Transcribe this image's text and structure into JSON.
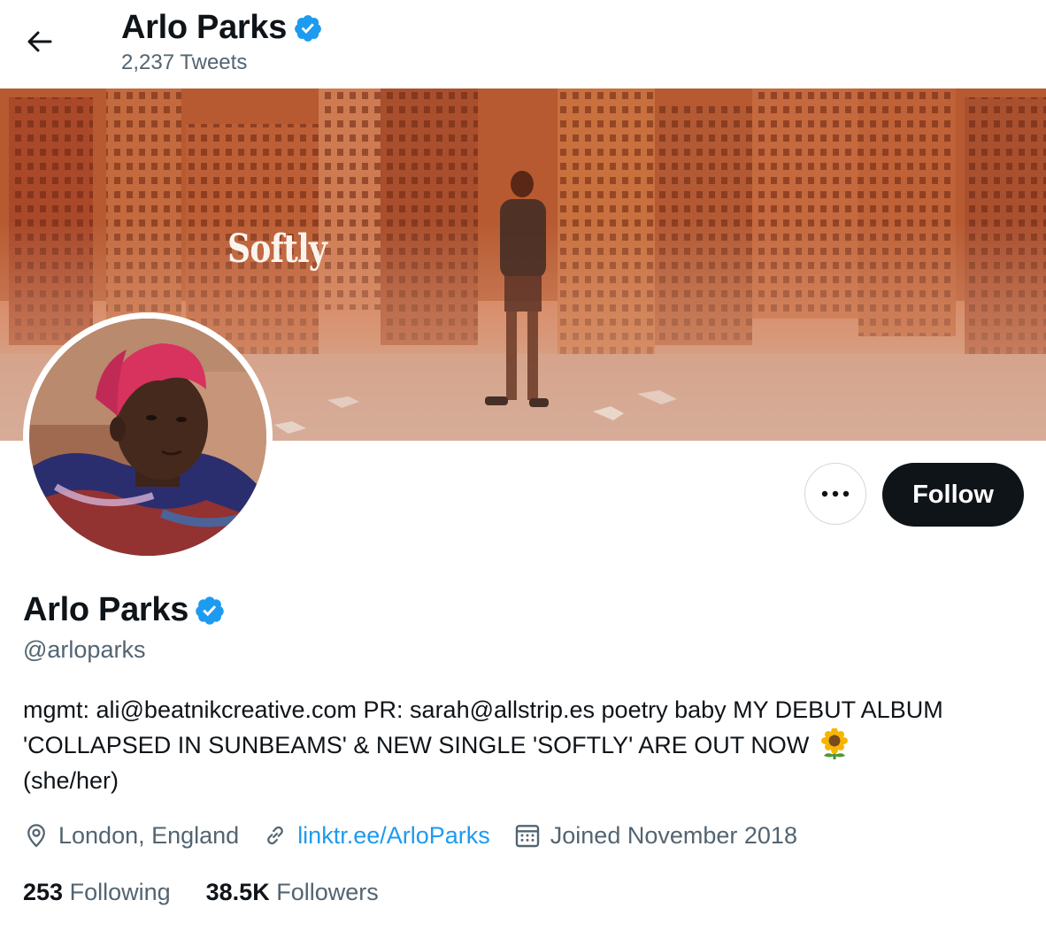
{
  "header": {
    "back_icon": "arrow-left-icon",
    "title": "Arlo Parks",
    "tweet_count": "2,237 Tweets"
  },
  "banner": {
    "logo_text": "Softly"
  },
  "actions": {
    "more_icon": "more-horizontal-icon",
    "follow_label": "Follow"
  },
  "profile": {
    "name": "Arlo Parks",
    "verified_icon": "verified-badge-icon",
    "handle": "@arloparks",
    "bio": "mgmt: ali@beatnikcreative.com PR: sarah@allstrip.es poetry baby MY DEBUT ALBUM 'COLLAPSED IN SUNBEAMS' & NEW SINGLE 'SOFTLY' ARE OUT NOW",
    "bio_emoji": "sunflower",
    "bio_end": "(she/her)",
    "location": "London, England",
    "location_icon": "location-pin-icon",
    "website": "linktr.ee/ArloParks",
    "website_icon": "link-icon",
    "joined": "Joined November 2018",
    "joined_icon": "calendar-icon",
    "following_count": "253",
    "following_label": "Following",
    "followers_count": "38.5K",
    "followers_label": "Followers"
  },
  "colors": {
    "accent": "#1d9bf0",
    "text_primary": "#0f1419",
    "text_secondary": "#536471",
    "follow_button_bg": "#0f1419",
    "border": "#cfd9de"
  }
}
